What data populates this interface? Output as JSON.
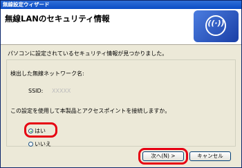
{
  "window": {
    "title": "無線設定ウィザード"
  },
  "header": {
    "title": "無線LANのセキュリティ情報"
  },
  "message": "パソコンに設定されているセキュリティ情報が見つかりました。",
  "detected": {
    "label": "検出した無線ネットワーク名:",
    "ssid_label": "SSID:",
    "ssid_value": "XXXXX"
  },
  "question": "この設定を使用して本製品とアクセスポイントを接続しますか。",
  "options": {
    "yes": "はい",
    "no": "いいえ",
    "selected": "yes"
  },
  "buttons": {
    "next": "次へ(N) >",
    "cancel": "キャンセル"
  },
  "colors": {
    "highlight": "#e60012"
  }
}
